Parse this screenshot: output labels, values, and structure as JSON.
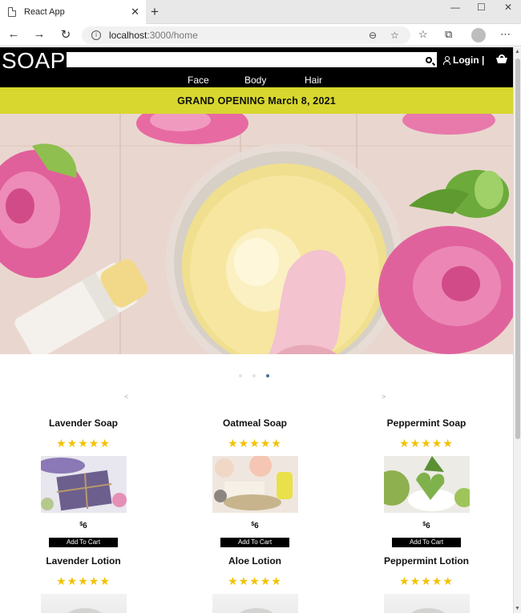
{
  "browser": {
    "tab_title": "React App",
    "tab_close": "✕",
    "new_tab": "+",
    "url_host": "localhost",
    "url_path": ":3000/home",
    "window_controls": [
      "—",
      "☐",
      "✕"
    ]
  },
  "site": {
    "logo": "SOAP",
    "login_label": "Login |",
    "nav": [
      "Face",
      "Body",
      "Hair"
    ],
    "banner": "GRAND OPENING March 8, 2021",
    "carousel_prev": "<",
    "carousel_next": ">",
    "carousel": {
      "count": 3,
      "active_index": 2
    }
  },
  "products": [
    {
      "name": "Lavender Soap",
      "stars": "★★★★★",
      "currency": "$",
      "price": "6",
      "cta": "Add To Cart",
      "image": "lavender-soap"
    },
    {
      "name": "Oatmeal Soap",
      "stars": "★★★★★",
      "currency": "$",
      "price": "6",
      "cta": "Add To Cart",
      "image": "oatmeal-soap"
    },
    {
      "name": "Peppermint Soap",
      "stars": "★★★★★",
      "currency": "$",
      "price": "6",
      "cta": "Add To Cart",
      "image": "peppermint-soap"
    },
    {
      "name": "Lavender Lotion",
      "stars": "★★★★★",
      "image": "lavender-lotion"
    },
    {
      "name": "Aloe Lotion",
      "stars": "★★★★★",
      "image": "aloe-lotion"
    },
    {
      "name": "Peppermint Lotion",
      "stars": "★★★★★",
      "image": "peppermint-lotion"
    }
  ],
  "colors": {
    "banner": "#d7d72f",
    "header": "#000000",
    "star": "#f2c200",
    "active_dot": "#4a6fa5"
  }
}
